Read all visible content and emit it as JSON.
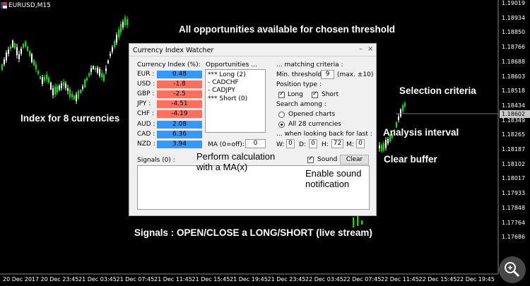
{
  "chart": {
    "symbol": "EURUSD,M15",
    "current_price": "1.18602",
    "price_labels": [
      "1.19019",
      "1.18934",
      "1.18850",
      "1.18766",
      "1.18688",
      "1.18603",
      "1.18518",
      "1.18434",
      "1.18349",
      "1.18265",
      "1.18187",
      "1.18102",
      "1.18017",
      "1.17933",
      "1.17848",
      "1.17764",
      "1.17686"
    ],
    "time_labels": [
      "20 Dec 2017",
      "20 Dec 23:45",
      "21 Dec 03:45",
      "21 Dec 07:45",
      "21 Dec 11:45",
      "21 Dec 15:45",
      "21 Dec 19:45",
      "21 Dec 23:45",
      "22 Dec 03:45",
      "22 Dec 07:45",
      "22 Dec 11:45",
      "22 Dec 15:45",
      "22 Dec 19:45"
    ],
    "bull_color": "#00e600",
    "bear_color": "#ffffff"
  },
  "annotations": {
    "top": "All opportunities available for chosen threshold",
    "selection": "Selection criteria",
    "index": "Index for 8 currencies",
    "analysis": "Analysis interval",
    "clear": "Clear buffer",
    "perform_line1": "Perform calculation",
    "perform_line2": "with a MA(x)",
    "sound_line1": "Enable sound",
    "sound_line2": "notification",
    "signals": "Signals : OPEN/CLOSE a LONG/SHORT (live stream)"
  },
  "dialog": {
    "title": "Currency Index Watcher",
    "minimize": "–",
    "close": "×",
    "index_header": "Currency Index (%):",
    "currencies": [
      {
        "code": "EUR :",
        "value": "0.48",
        "color": "#3399ff"
      },
      {
        "code": "USD :",
        "value": "-1.8",
        "color": "#ff6f5e"
      },
      {
        "code": "GBP :",
        "value": "-2.5",
        "color": "#ff6f5e"
      },
      {
        "code": "JPY :",
        "value": "-4.51",
        "color": "#ff6f5e"
      },
      {
        "code": "CHF :",
        "value": "-4.19",
        "color": "#ff6f5e"
      },
      {
        "code": "AUD :",
        "value": "2.08",
        "color": "#3399ff"
      },
      {
        "code": "CAD :",
        "value": "6.36",
        "color": "#3399ff"
      },
      {
        "code": "NZD :",
        "value": "3.94",
        "color": "#3399ff"
      }
    ],
    "opportunities_header": "Opportunities ...",
    "opportunities": [
      "*** Long (2)",
      "- CADCHF",
      "- CADJPY",
      "*** Short (0)"
    ],
    "criteria_header": "... matching criteria :",
    "min_threshold_label": "Min. threshold:",
    "min_threshold_value": "9",
    "max_label": "(max. ±10)",
    "position_type_label": "Position type :",
    "long_label": "Long",
    "short_label": "Short",
    "search_among_label": "Search among :",
    "opened_charts_label": "Opened charts",
    "all_currencies_label": "All 28 currencies",
    "looking_back_label": "... when looking back for last :",
    "w_label": "W:",
    "w_value": "0",
    "d_label": "D:",
    "d_value": "0",
    "h_label": "H:",
    "h_value": "72",
    "m_label": "M:",
    "m_value": "0",
    "ma_label": "MA (0=off):",
    "ma_value": "0",
    "signals_label": "Signals (0) :",
    "sound_label": "Sound",
    "clear_button": "Clear"
  }
}
